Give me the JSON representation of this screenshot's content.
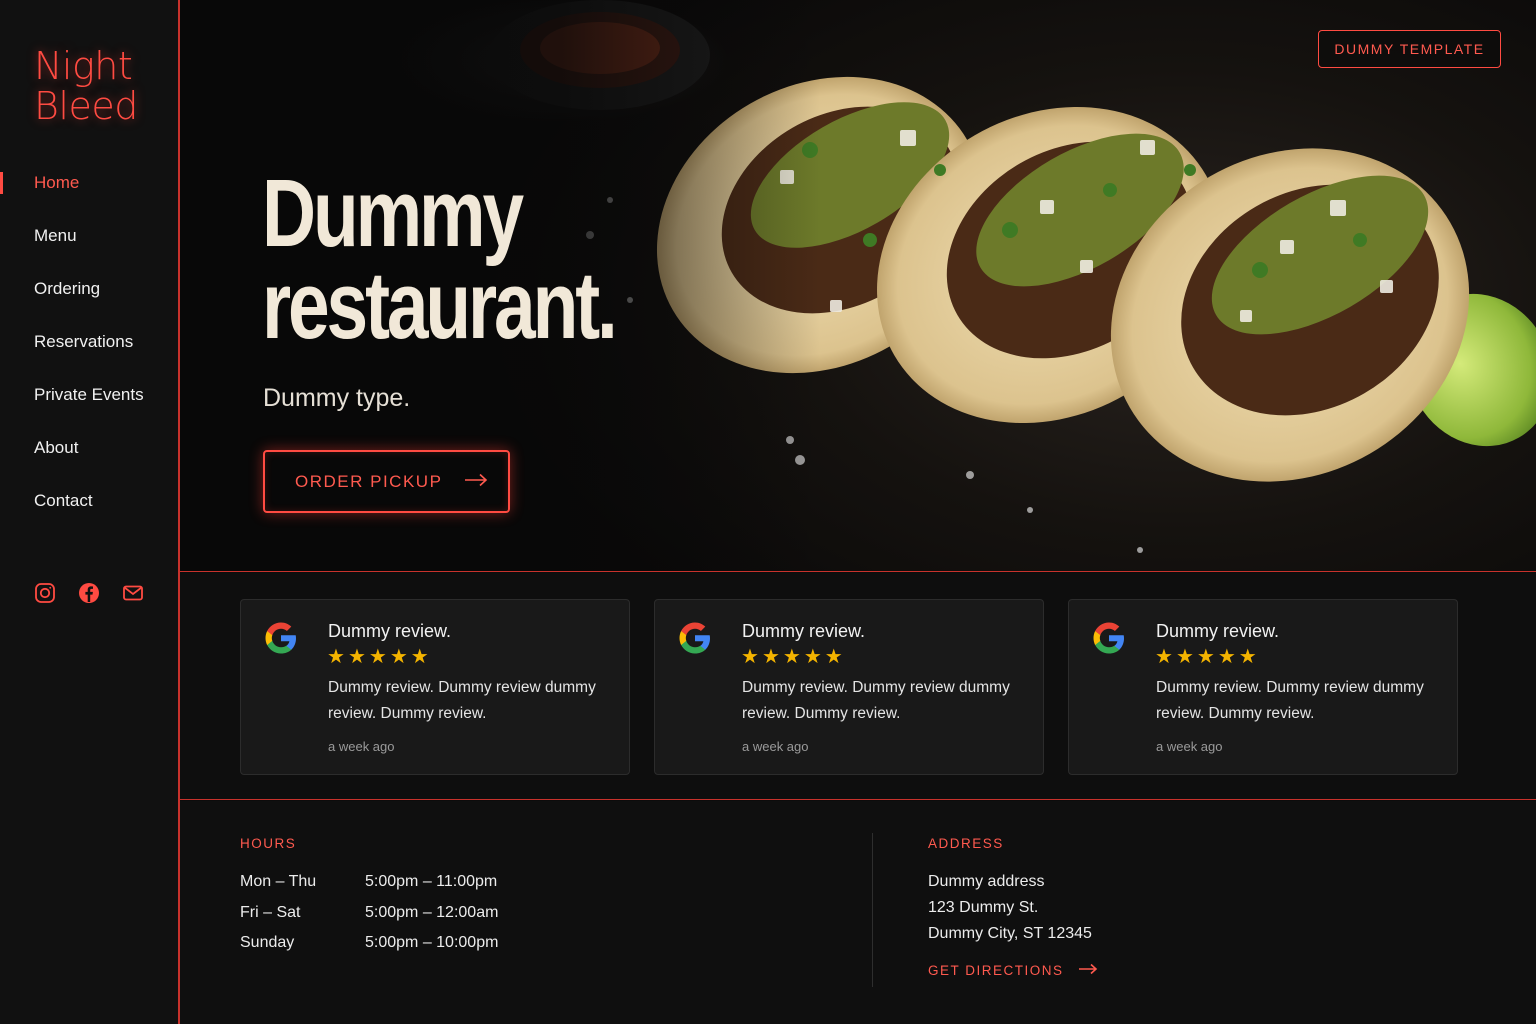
{
  "brand": {
    "line1": "Night",
    "line2": "Bleed",
    "accent": "#ff4b42"
  },
  "nav": [
    {
      "label": "Home",
      "active": true
    },
    {
      "label": "Menu"
    },
    {
      "label": "Ordering"
    },
    {
      "label": "Reservations"
    },
    {
      "label": "Private Events"
    },
    {
      "label": "About"
    },
    {
      "label": "Contact"
    }
  ],
  "social": [
    "instagram-icon",
    "facebook-icon",
    "mail-icon"
  ],
  "hero": {
    "title_line1": "Dummy",
    "title_line2": "restaurant.",
    "subtitle": "Dummy type.",
    "cta": "ORDER PICKUP",
    "badge": "DUMMY TEMPLATE"
  },
  "reviews": [
    {
      "title": "Dummy review.",
      "rating": 5,
      "body": "Dummy review. Dummy review dummy review. Dummy review.",
      "time": "a week ago"
    },
    {
      "title": "Dummy review.",
      "rating": 5,
      "body": "Dummy review. Dummy review dummy review. Dummy review.",
      "time": "a week ago"
    },
    {
      "title": "Dummy review.",
      "rating": 5,
      "body": "Dummy review. Dummy review dummy review. Dummy review.",
      "time": "a week ago"
    }
  ],
  "hours": {
    "label": "HOURS",
    "rows": [
      {
        "day": "Mon – Thu",
        "time": "5:00pm – 11:00pm"
      },
      {
        "day": "Fri – Sat",
        "time": "5:00pm – 12:00am"
      },
      {
        "day": "Sunday",
        "time": "5:00pm – 10:00pm"
      }
    ]
  },
  "address": {
    "label": "ADDRESS",
    "lines": [
      "Dummy address",
      "123 Dummy St.",
      "Dummy City, ST 12345"
    ],
    "directions": "GET DIRECTIONS"
  }
}
